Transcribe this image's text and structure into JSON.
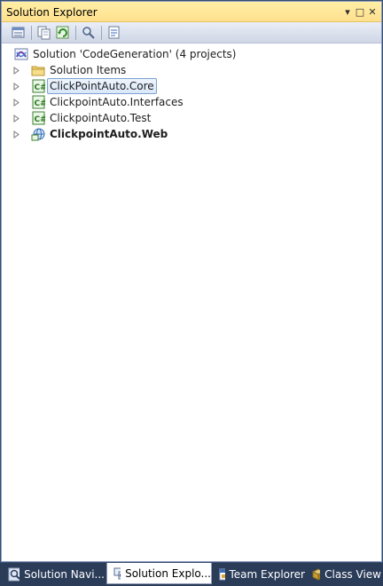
{
  "window": {
    "title": "Solution Explorer"
  },
  "title_buttons": {
    "dropdown": "▾",
    "maximize": "□",
    "close": "✕"
  },
  "toolbar": {
    "tools": [
      "properties-icon",
      "show-all-files-icon",
      "refresh-icon",
      "view-class-diagram-icon",
      "view-code-icon"
    ]
  },
  "tree": {
    "solution_label": "Solution 'CodeGeneration' (4 projects)",
    "items": [
      {
        "label": "Solution Items",
        "kind": "folder",
        "selected": false,
        "bold": false
      },
      {
        "label": "ClickPointAuto.Core",
        "kind": "project",
        "selected": true,
        "bold": false
      },
      {
        "label": "ClickpointAuto.Interfaces",
        "kind": "project",
        "selected": false,
        "bold": false
      },
      {
        "label": "ClickpointAuto.Test",
        "kind": "project",
        "selected": false,
        "bold": false
      },
      {
        "label": "ClickpointAuto.Web",
        "kind": "web-project",
        "selected": false,
        "bold": true
      }
    ]
  },
  "tabs": [
    {
      "label": "Solution Navi...",
      "icon": "solution-navigator-icon",
      "active": false
    },
    {
      "label": "Solution Explo...",
      "icon": "solution-explorer-icon",
      "active": true
    },
    {
      "label": "Team Explorer",
      "icon": "team-explorer-icon",
      "active": false
    },
    {
      "label": "Class View",
      "icon": "class-view-icon",
      "active": false
    }
  ],
  "colors": {
    "titlebar": "#ffe08e",
    "tab_strip": "#2b3c59",
    "selection_border": "#7da2ce"
  }
}
